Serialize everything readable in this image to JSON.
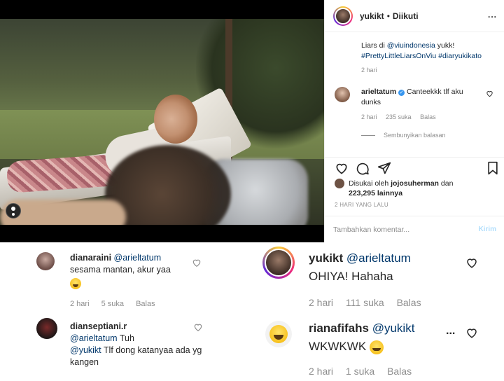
{
  "post": {
    "header": {
      "username": "yukikt",
      "separator": "•",
      "follow_status": "Diikuti",
      "more": "..."
    },
    "caption": {
      "text": "Liars di ",
      "mention": "@viuindonesia",
      "text2": " yukk!",
      "hashtags": "#PrettyLittleLiarsOnViu #diaryukikato",
      "time": "2 hari"
    },
    "comment": {
      "username": "arieltatum",
      "verified": "✓",
      "text": " Canteekkk tlf aku dunks",
      "time": "2 hari",
      "likes": "235 suka",
      "reply": "Balas",
      "hide_replies": "Sembunyikan balasan"
    },
    "likes": {
      "prefix": "Disukai oleh ",
      "user": "jojosuherman",
      "middle": " dan ",
      "count": "223,295",
      "suffix": " lainnya"
    },
    "time": "2 HARI YANG LALU",
    "add_comment": {
      "placeholder": "Tambahkan komentar...",
      "send": "Kirim"
    }
  },
  "zoom_left": [
    {
      "username": "dianaraini",
      "mention": "@arieltatum",
      "text": "sesama mantan, akur yaa",
      "time": "2 hari",
      "likes": "5 suka",
      "reply": "Balas"
    },
    {
      "username": "dianseptiani.r",
      "mention": "@arieltatum",
      "text": " Tuh",
      "mention2": "@yukikt",
      "text2": " Tlf dong katanyaa ada yg kangen"
    }
  ],
  "zoom_right": [
    {
      "username": "yukikt",
      "mention": "@arieltatum",
      "text": "OHIYA! Hahaha",
      "time": "2 hari",
      "likes": "111 suka",
      "reply": "Balas"
    },
    {
      "username": "rianafifahs",
      "mention": "@yukikt",
      "text": "WKWKWK",
      "time": "2 hari",
      "likes": "1 suka",
      "reply": "Balas",
      "more": "..."
    }
  ],
  "colors": {
    "link": "#00376b",
    "muted": "#8e8e8e",
    "verified": "#3897f0",
    "send": "#b2dffc"
  }
}
